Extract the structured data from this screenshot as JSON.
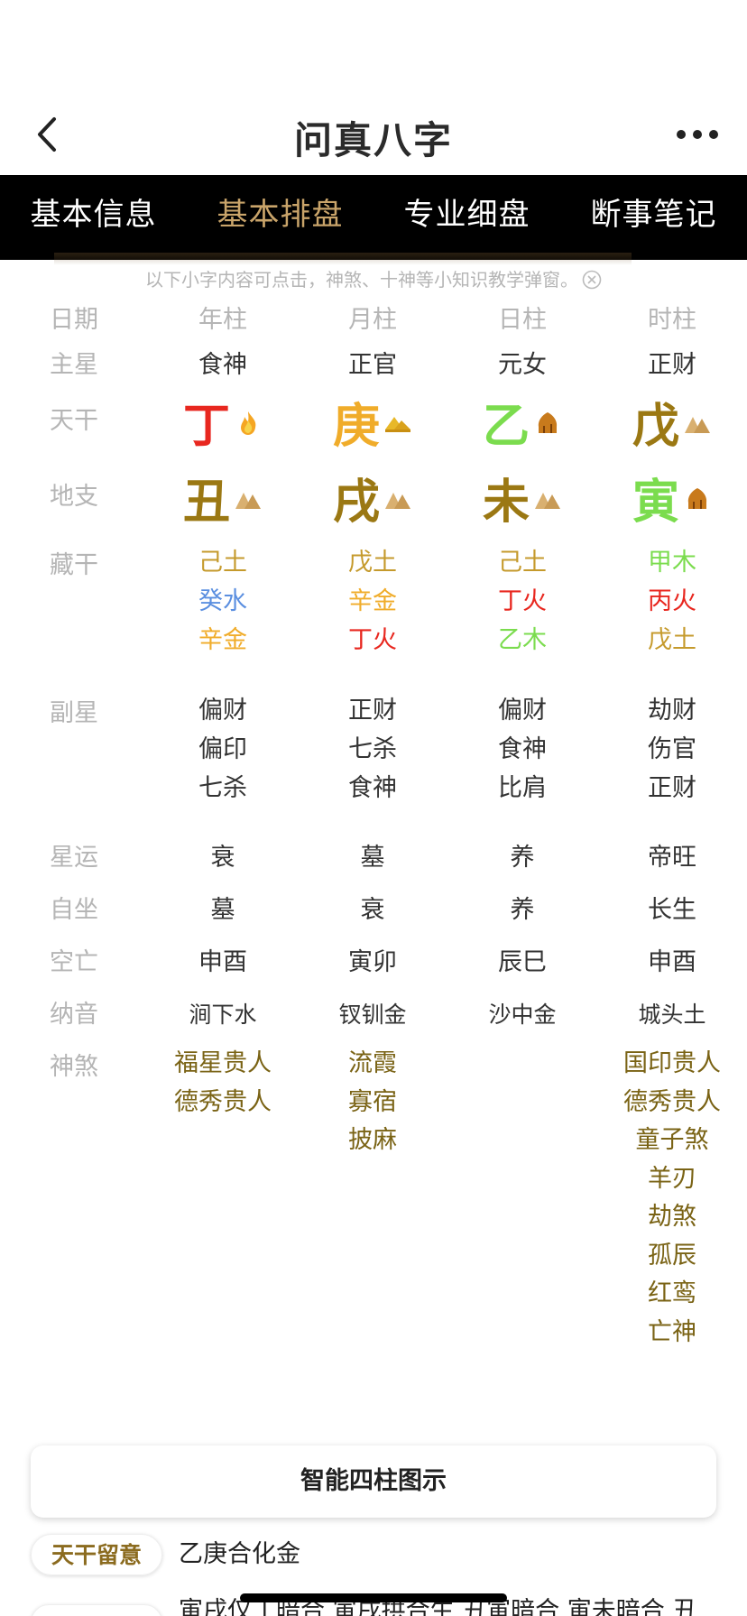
{
  "header": {
    "title": "问真八字"
  },
  "tabs": [
    {
      "label": "基本信息",
      "active": false
    },
    {
      "label": "基本排盘",
      "active": true
    },
    {
      "label": "专业细盘",
      "active": false
    },
    {
      "label": "断事笔记",
      "active": false
    }
  ],
  "hint": "以下小字内容可点击，神煞、十神等小知识教学弹窗。",
  "colors": {
    "fire": "#e8271f",
    "metal": "#f0ac2a",
    "wood": "#7bdc4e",
    "earth": "#9b7813",
    "water": "#5b8fe0",
    "accent": "#c9a46a",
    "shensha": "#7a6315"
  },
  "labels": {
    "date": "日期",
    "main_star": "主星",
    "tiangan": "天干",
    "dizhi": "地支",
    "canggan": "藏干",
    "fuxing": "副星",
    "xingyun": "星运",
    "zizuo": "自坐",
    "kongwang": "空亡",
    "nayin": "纳音",
    "shensha": "神煞"
  },
  "pillars": [
    {
      "header": "年柱",
      "main_star": "食神",
      "tiangan": {
        "char": "丁",
        "icon": "fire-icon",
        "color": "#e8271f"
      },
      "dizhi": {
        "char": "丑",
        "icon": "earth-icon",
        "color": "#9b7813"
      },
      "canggan": [
        {
          "text": "己土",
          "color": "#c59a2c"
        },
        {
          "text": "癸水",
          "color": "#5b8fe0"
        },
        {
          "text": "辛金",
          "color": "#f0ac2a"
        }
      ],
      "fuxing": [
        "偏财",
        "偏印",
        "七杀"
      ],
      "xingyun": "衰",
      "zizuo": "墓",
      "kongwang": "申酉",
      "nayin": "涧下水",
      "shensha": [
        "福星贵人",
        "德秀贵人"
      ]
    },
    {
      "header": "月柱",
      "main_star": "正官",
      "tiangan": {
        "char": "庚",
        "icon": "metal-icon",
        "color": "#f0ac2a"
      },
      "dizhi": {
        "char": "戌",
        "icon": "earth-icon",
        "color": "#9b7813"
      },
      "canggan": [
        {
          "text": "戊土",
          "color": "#c59a2c"
        },
        {
          "text": "辛金",
          "color": "#f0ac2a"
        },
        {
          "text": "丁火",
          "color": "#e8271f"
        }
      ],
      "fuxing": [
        "正财",
        "七杀",
        "食神"
      ],
      "xingyun": "墓",
      "zizuo": "衰",
      "kongwang": "寅卯",
      "nayin": "钗钏金",
      "shensha": [
        "流霞",
        "寡宿",
        "披麻"
      ]
    },
    {
      "header": "日柱",
      "main_star": "元女",
      "tiangan": {
        "char": "乙",
        "icon": "wood-icon",
        "color": "#7bdc4e"
      },
      "dizhi": {
        "char": "未",
        "icon": "earth-icon",
        "color": "#9b7813"
      },
      "canggan": [
        {
          "text": "己土",
          "color": "#c59a2c"
        },
        {
          "text": "丁火",
          "color": "#e8271f"
        },
        {
          "text": "乙木",
          "color": "#7bdc4e"
        }
      ],
      "fuxing": [
        "偏财",
        "食神",
        "比肩"
      ],
      "xingyun": "养",
      "zizuo": "养",
      "kongwang": "辰巳",
      "nayin": "沙中金",
      "shensha": []
    },
    {
      "header": "时柱",
      "main_star": "正财",
      "tiangan": {
        "char": "戊",
        "icon": "earth-icon",
        "color": "#9b7813"
      },
      "dizhi": {
        "char": "寅",
        "icon": "wood-icon",
        "color": "#7bdc4e"
      },
      "canggan": [
        {
          "text": "甲木",
          "color": "#7bdc4e"
        },
        {
          "text": "丙火",
          "color": "#e8271f"
        },
        {
          "text": "戊土",
          "color": "#c59a2c"
        }
      ],
      "fuxing": [
        "劫财",
        "伤官",
        "正财"
      ],
      "xingyun": "帝旺",
      "zizuo": "长生",
      "kongwang": "申酉",
      "nayin": "城头土",
      "shensha": [
        "国印贵人",
        "德秀贵人",
        "童子煞",
        "羊刃",
        "劫煞",
        "孤辰",
        "红鸾",
        "亡神"
      ]
    }
  ],
  "panel": {
    "label": "智能四柱图示"
  },
  "notes": [
    {
      "tag": "天干留意",
      "text": "乙庚合化金"
    },
    {
      "tag": "",
      "text": "寅戌仅丁暗合 寅戌拱合生 丑寅暗合 寅未暗合 丑"
    }
  ]
}
